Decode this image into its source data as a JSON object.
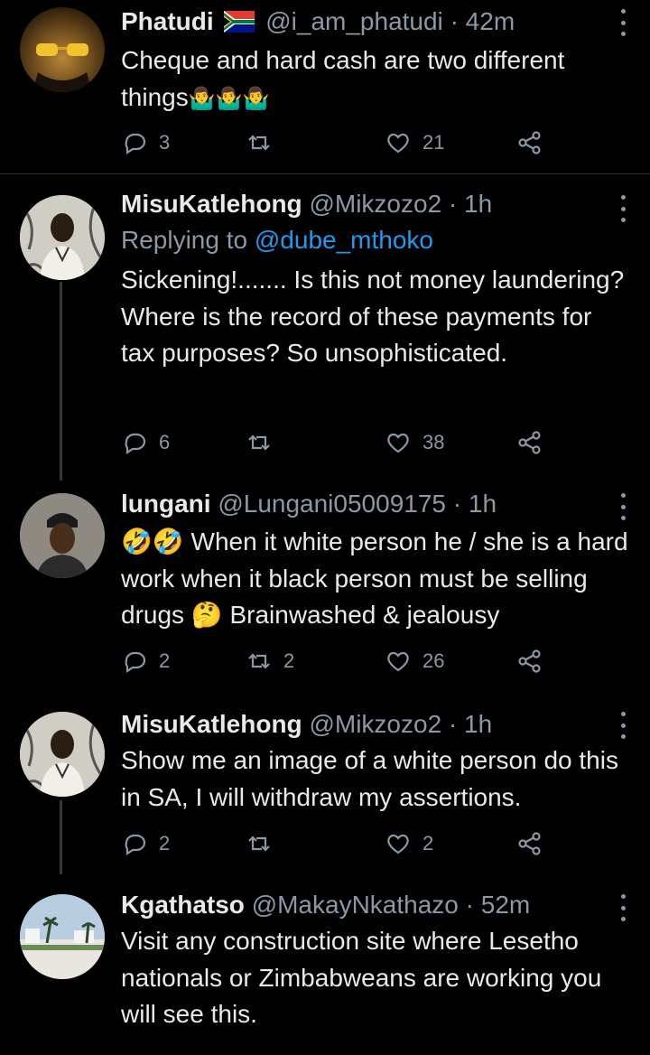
{
  "tweets": [
    {
      "name": "Phatudi",
      "flag": "south-africa-flag",
      "handle": "@i_am_phatudi",
      "time": "42m",
      "reply_to_prefix": "",
      "reply_to": "",
      "text": "Cheque and hard cash are two different things",
      "emoji_trail": "🤷‍♂️🤷‍♂️🤷‍♂️",
      "replies": "3",
      "retweets": "",
      "likes": "21"
    },
    {
      "name": "MisuKatlehong",
      "handle": "@Mikzozo2",
      "time": "1h",
      "reply_to_prefix": "Replying to",
      "reply_to": "@dube_mthoko",
      "text": "Sickening!....... Is this not money laundering? Where is the record of these payments for tax purposes? So unsophisticated.",
      "replies": "6",
      "retweets": "",
      "likes": "38"
    },
    {
      "name": "lungani",
      "handle": "@Lungani05009175",
      "time": "1h",
      "emoji_lead": "🤣🤣",
      "text_a": "When it white person he / she is a hard work when it black person must be selling drugs",
      "emoji_mid": "🤔",
      "text_b": "Brainwashed & jealousy",
      "replies": "2",
      "retweets": "2",
      "likes": "26"
    },
    {
      "name": "MisuKatlehong",
      "handle": "@Mikzozo2",
      "time": "1h",
      "text": "Show me an image of a white person do this in SA, I will withdraw my assertions.",
      "replies": "2",
      "retweets": "",
      "likes": "2"
    },
    {
      "name": "Kgathatso",
      "handle": "@MakayNkathazo",
      "time": "52m",
      "text": "Visit any construction site where Lesetho nationals or Zimbabweans are working you will see this."
    }
  ],
  "separator": "·",
  "colors": {
    "background": "#000000",
    "text": "#e7e9ea",
    "muted": "#8b98a5",
    "link": "#1d9bf0"
  }
}
